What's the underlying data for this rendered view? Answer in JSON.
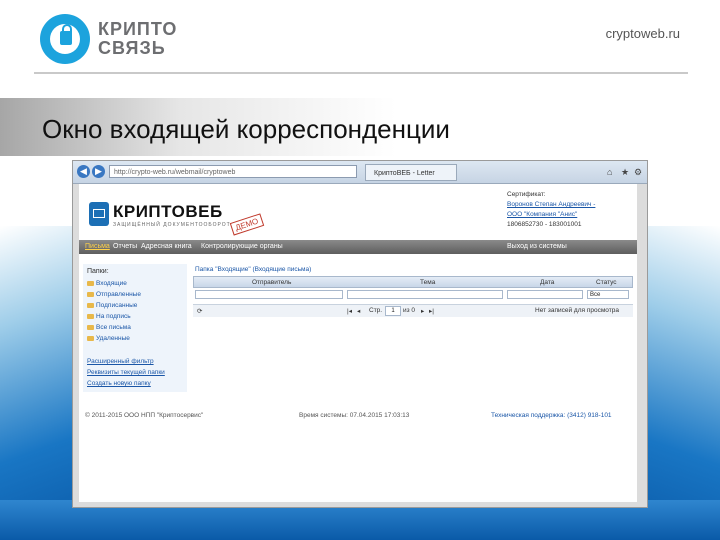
{
  "slide": {
    "logo_line1": "КРИПТО",
    "logo_line2": "СВЯЗЬ",
    "url": "cryptoweb.ru",
    "title": "Окно входящей корреспонденции"
  },
  "browser": {
    "address": "http://crypto-web.ru/webmail/cryptoweb",
    "tab_title": "КриптоВЕБ - Letter"
  },
  "app": {
    "name": "КРИПТОВЕБ",
    "subtitle": "ЗАЩИЩЁННЫЙ ДОКУМЕНТООБОРОТ",
    "demo_badge": "ДЕМО",
    "user": {
      "label": "Сертификат:",
      "name_line1": "Воронов Степан Андреевич -",
      "name_line2": "ООО \"Компания \"Анис\"",
      "ids": "1806852730 - 183001001"
    },
    "menu": [
      {
        "label": "Письма"
      },
      {
        "label": "Отчеты"
      },
      {
        "label": "Адресная книга"
      },
      {
        "label": "Контролирующие органы"
      },
      {
        "label": "Выход из системы"
      }
    ],
    "sidebar": {
      "header": "Папки:",
      "folders": [
        {
          "label": "Входящие"
        },
        {
          "label": "Отправленные"
        },
        {
          "label": "Подписанные"
        },
        {
          "label": "На подпись"
        },
        {
          "label": "Все письма"
        },
        {
          "label": "Удаленные"
        }
      ],
      "links": [
        {
          "label": "Расширенный фильтр"
        },
        {
          "label": "Реквизиты текущей папки"
        },
        {
          "label": "Создать новую папку"
        }
      ]
    },
    "folder_title": "Папка \"Входящие\" (Входящие письма)",
    "grid": {
      "columns": [
        "Отправитель",
        "Тема",
        "Дата",
        "Статус"
      ],
      "status_filter": "Все"
    },
    "pager": {
      "page_label": "Стр.",
      "page_value": "1",
      "of_label": "из 0",
      "empty_text": "Нет записей для просмотра"
    },
    "footer": {
      "copyright": "© 2011-2015 ООО НПП \"Криптосервис\"",
      "system_time": "Время системы: 07.04.2015 17:03:13",
      "support": "Техническая поддержка: (3412) 918-101"
    }
  }
}
